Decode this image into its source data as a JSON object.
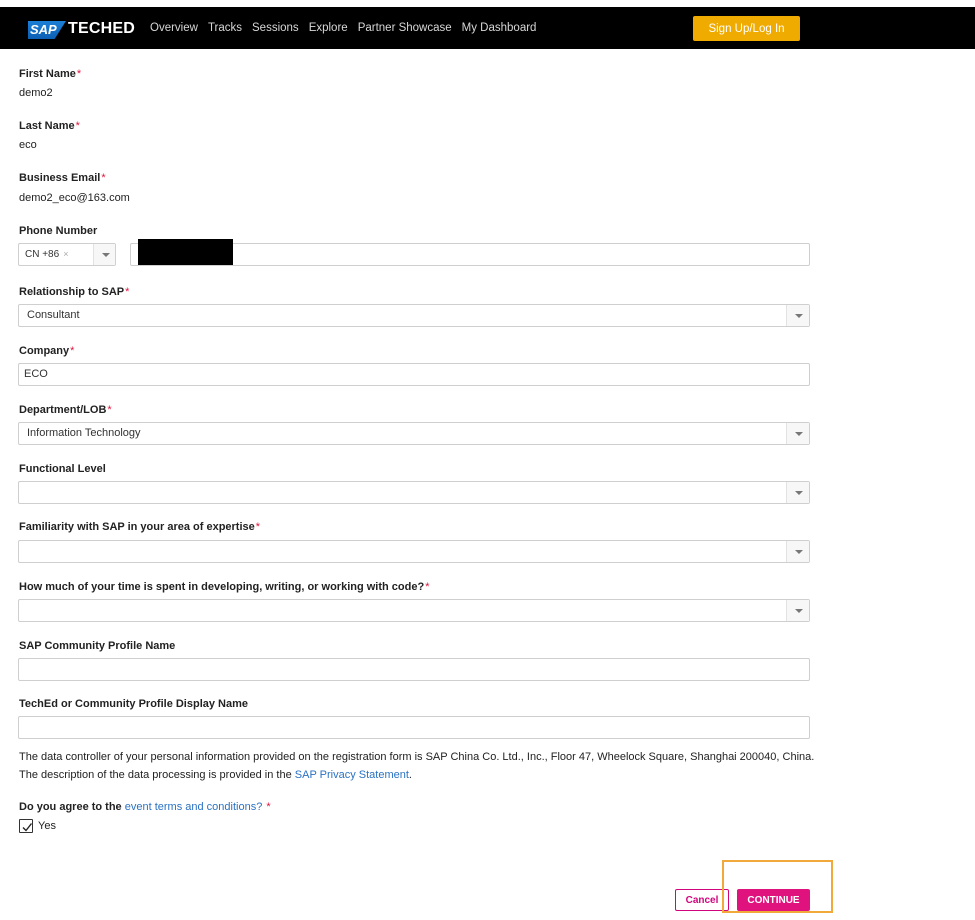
{
  "header": {
    "logo_mark": "SAP",
    "logo_text": "TECHED",
    "nav": [
      "Overview",
      "Tracks",
      "Sessions",
      "Explore",
      "Partner Showcase",
      "My Dashboard"
    ],
    "signup_label": "Sign Up/Log In"
  },
  "form": {
    "first_name": {
      "label": "First Name",
      "value": "demo2"
    },
    "last_name": {
      "label": "Last Name",
      "value": "eco"
    },
    "email": {
      "label": "Business Email",
      "value": "demo2_eco@163.com"
    },
    "phone": {
      "label": "Phone Number",
      "country_code": "CN +86",
      "clear": "×"
    },
    "relationship": {
      "label": "Relationship to SAP",
      "value": "Consultant"
    },
    "company": {
      "label": "Company",
      "value": "ECO"
    },
    "department": {
      "label": "Department/LOB",
      "value": "Information Technology"
    },
    "functional_level": {
      "label": "Functional Level",
      "value": ""
    },
    "familiarity": {
      "label": "Familiarity with SAP in your area of expertise",
      "value": ""
    },
    "coding_time": {
      "label": "How much of your time is spent in developing, writing, or working with code?",
      "value": ""
    },
    "community_profile": {
      "label": "SAP Community Profile Name",
      "value": ""
    },
    "display_name": {
      "label": "TechEd or Community Profile Display Name",
      "value": ""
    },
    "required_mark": "*"
  },
  "privacy": {
    "line1": "The data controller of your personal information provided on the registration form is SAP China Co. Ltd., Inc., Floor 47, Wheelock Square, Shanghai 200040, China.",
    "line2_prefix": "The description of the data processing is provided in the ",
    "line2_link": "SAP Privacy Statement",
    "line2_suffix": "."
  },
  "agree": {
    "prefix": "Do you agree to the ",
    "link": "event terms and conditions?",
    "checkbox_label": "Yes",
    "checked": true
  },
  "actions": {
    "cancel": "Cancel",
    "continue": "CONTINUE"
  },
  "colors": {
    "accent": "#e0127e",
    "signup": "#f0ab00",
    "link": "#2a72c2",
    "highlight": "#f2a93b"
  }
}
